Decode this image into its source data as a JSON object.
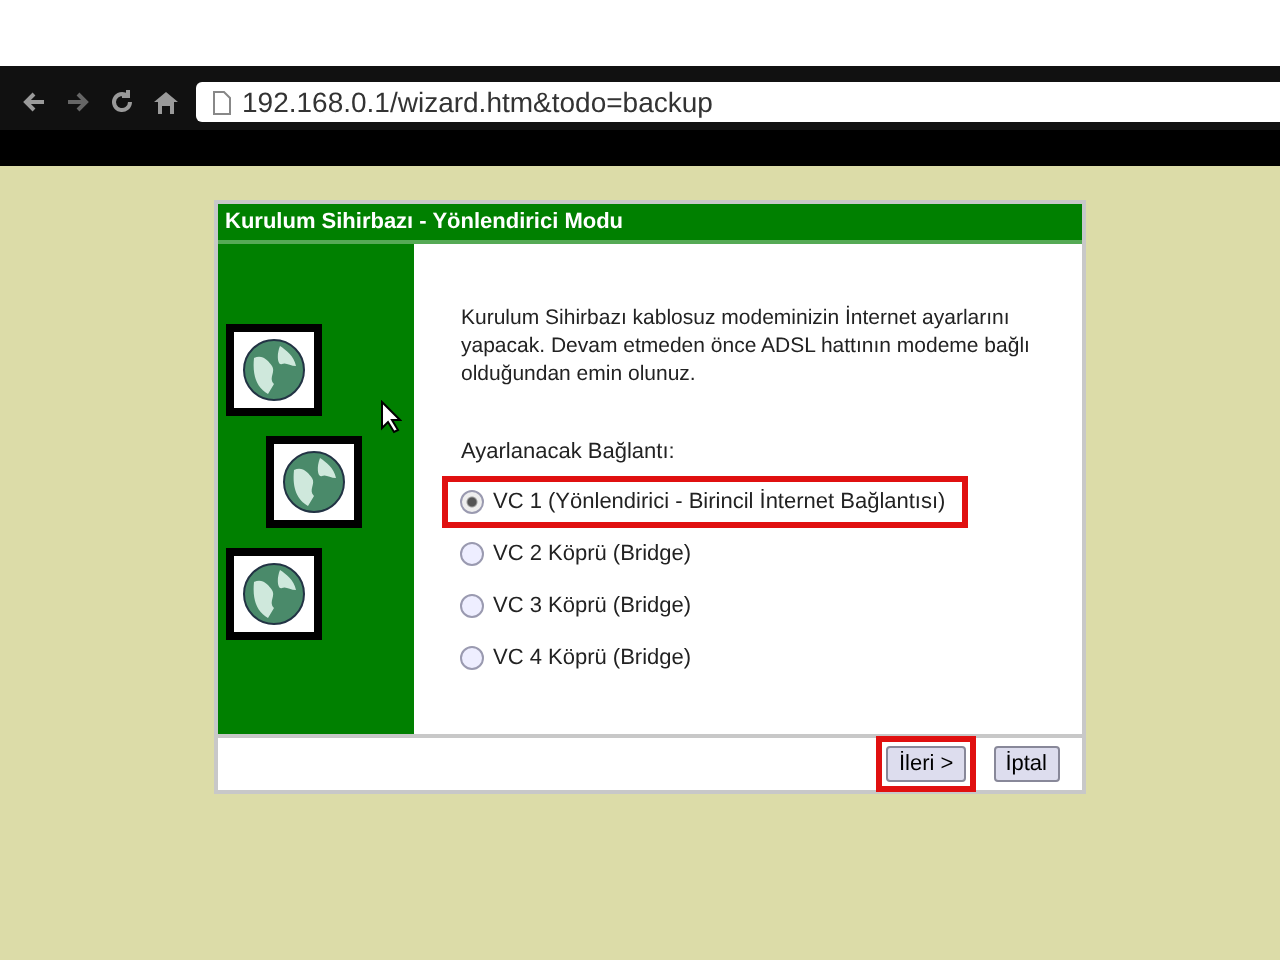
{
  "browser": {
    "address": "192.168.0.1/wizard.htm&todo=backup"
  },
  "dialog": {
    "title": "Kurulum Sihirbazı - Yönlendirici Modu",
    "intro": "Kurulum Sihirbazı kablosuz modeminizin İnternet ayarlarını yapacak. Devam etmeden önce ADSL hattının modeme bağlı olduğundan emin olunuz.",
    "connection_label": "Ayarlanacak Bağlantı:",
    "options": [
      {
        "label": "VC 1 (Yönlendirici - Birincil İnternet Bağlantısı)",
        "selected": true,
        "highlighted": true
      },
      {
        "label": "VC 2 Köprü (Bridge)",
        "selected": false,
        "highlighted": false
      },
      {
        "label": "VC 3 Köprü (Bridge)",
        "selected": false,
        "highlighted": false
      },
      {
        "label": "VC 4 Köprü (Bridge)",
        "selected": false,
        "highlighted": false
      }
    ],
    "buttons": [
      {
        "label": "İleri >",
        "highlighted": true
      },
      {
        "label": "İptal",
        "highlighted": false
      }
    ]
  }
}
